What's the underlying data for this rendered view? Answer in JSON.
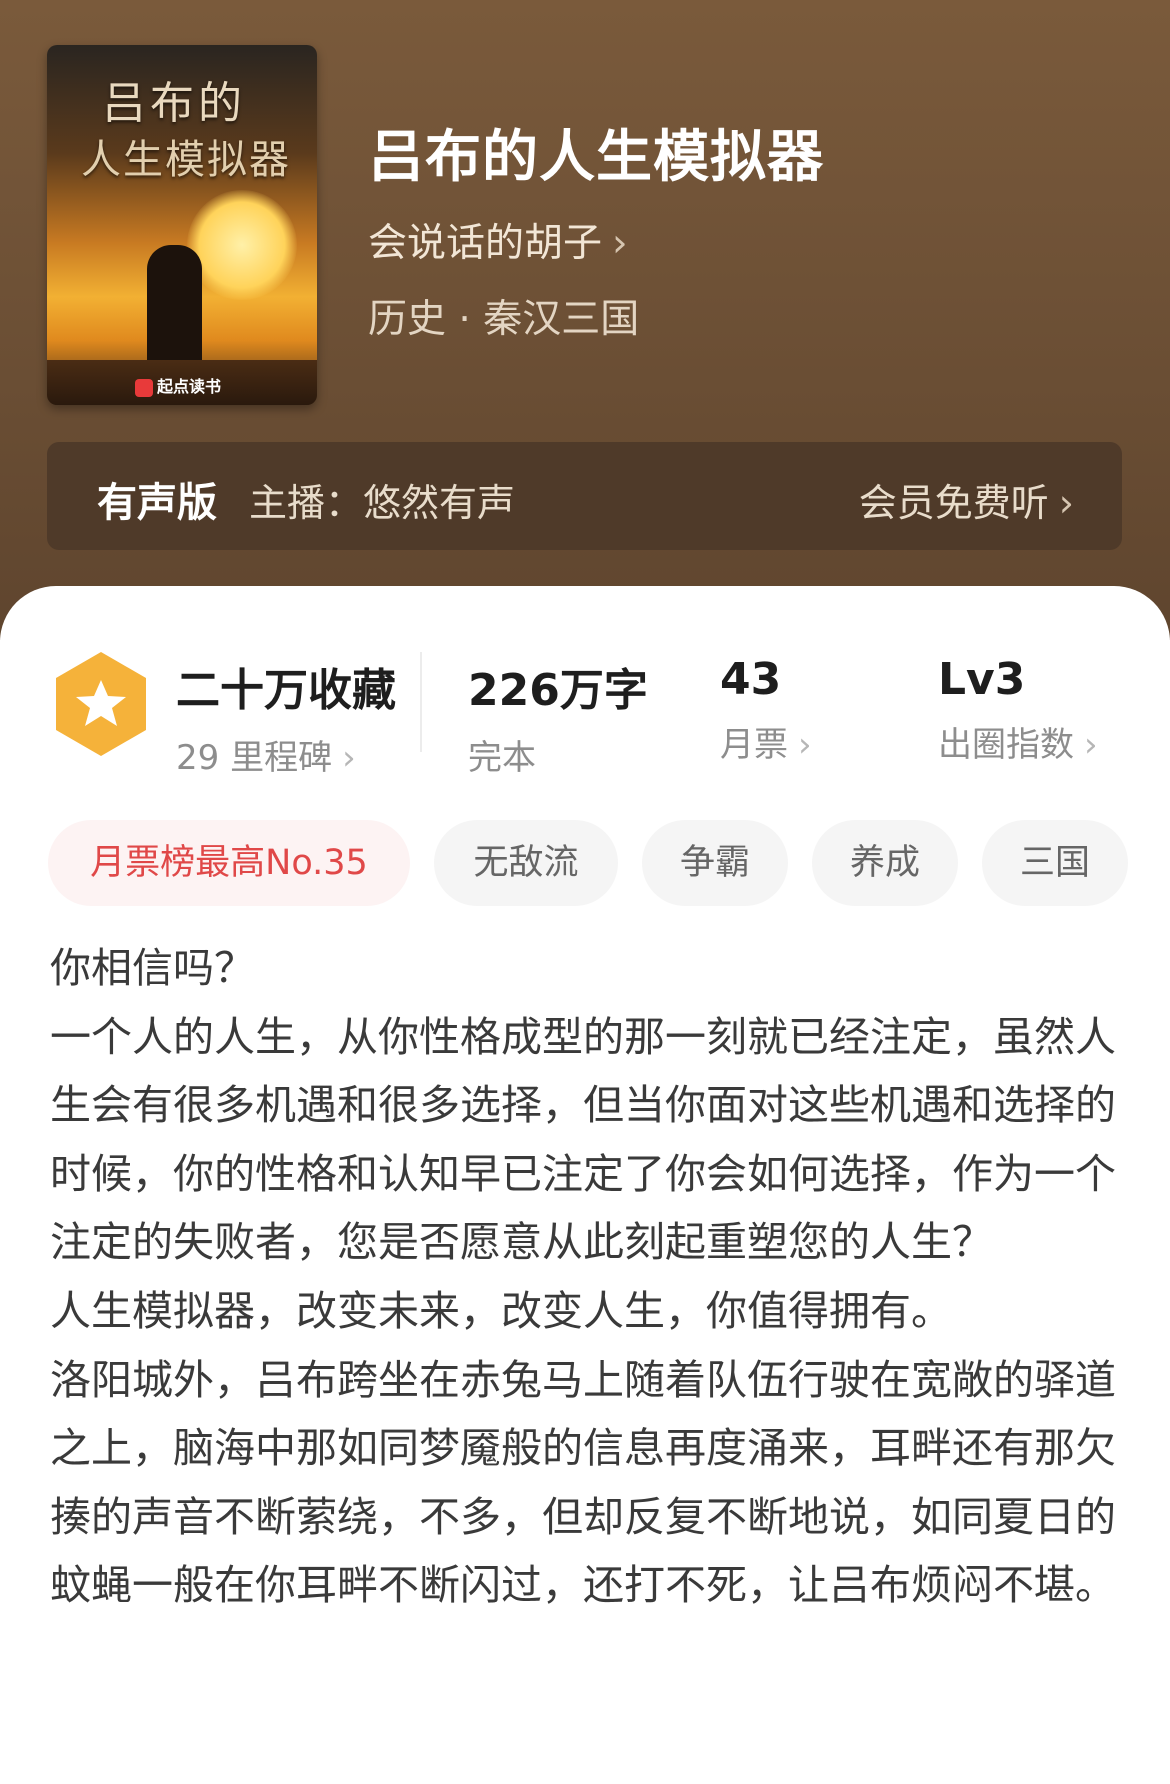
{
  "book": {
    "title": "吕布的人生模拟器",
    "author": "会说话的胡子",
    "genre": "历史 · 秦汉三国",
    "cover": {
      "title_line1": "吕布的",
      "title_line2": "人生模拟器",
      "publisher": "起点读书"
    }
  },
  "audio": {
    "label": "有声版",
    "host": "主播：悠然有声",
    "action": "会员免费听"
  },
  "stats": {
    "collection": "二十万收藏",
    "milestones": "29 里程碑",
    "words": "226万字",
    "status": "完本",
    "monthly_votes": "43",
    "monthly_votes_label": "月票",
    "level": "Lv3",
    "level_label": "出圈指数"
  },
  "tags": [
    "月票榜最高No.35",
    "无敌流",
    "争霸",
    "养成",
    "三国"
  ],
  "description": [
    "你相信吗？",
    "一个人的人生，从你性格成型的那一刻就已经注定，虽然人生会有很多机遇和很多选择，但当你面对这些机遇和选择的时候，你的性格和认知早已注定了你会如何选择，作为一个注定的失败者，您是否愿意从此刻起重塑您的人生？",
    "人生模拟器，改变未来，改变人生，你值得拥有。",
    "洛阳城外，吕布跨坐在赤兔马上随着队伍行驶在宽敞的驿道之上，脑海中那如同梦魇般的信息再度涌来，耳畔还有那欠揍的声音不断萦绕，不多，但却反复不断地说，如同夏日的蚊蝇一般在你耳畔不断闪过，还打不死，让吕布烦闷不堪。"
  ],
  "colors": {
    "hero_bg": "#6e5136",
    "accent_red": "#e04848",
    "medal": "#f5b23a"
  },
  "icons": [
    "chevron-right-icon",
    "star-medal-icon"
  ]
}
